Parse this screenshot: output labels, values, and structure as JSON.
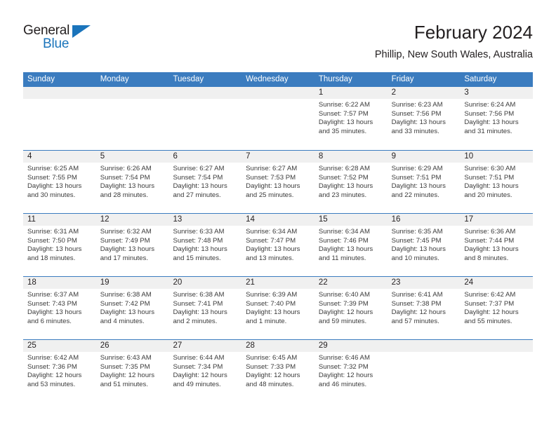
{
  "brand": {
    "name_top": "General",
    "name_bottom": "Blue",
    "accent_color": "#1a74bb"
  },
  "header": {
    "title": "February 2024",
    "subtitle": "Phillip, New South Wales, Australia"
  },
  "theme": {
    "header_blue": "#3b7cbf",
    "day_band_gray": "#f0f0f0",
    "text_dark": "#231f20"
  },
  "weekdays": [
    "Sunday",
    "Monday",
    "Tuesday",
    "Wednesday",
    "Thursday",
    "Friday",
    "Saturday"
  ],
  "weeks": [
    [
      {
        "day": "",
        "sunrise": "",
        "sunset": "",
        "daylight_1": "",
        "daylight_2": ""
      },
      {
        "day": "",
        "sunrise": "",
        "sunset": "",
        "daylight_1": "",
        "daylight_2": ""
      },
      {
        "day": "",
        "sunrise": "",
        "sunset": "",
        "daylight_1": "",
        "daylight_2": ""
      },
      {
        "day": "",
        "sunrise": "",
        "sunset": "",
        "daylight_1": "",
        "daylight_2": ""
      },
      {
        "day": "1",
        "sunrise": "Sunrise: 6:22 AM",
        "sunset": "Sunset: 7:57 PM",
        "daylight_1": "Daylight: 13 hours",
        "daylight_2": "and 35 minutes."
      },
      {
        "day": "2",
        "sunrise": "Sunrise: 6:23 AM",
        "sunset": "Sunset: 7:56 PM",
        "daylight_1": "Daylight: 13 hours",
        "daylight_2": "and 33 minutes."
      },
      {
        "day": "3",
        "sunrise": "Sunrise: 6:24 AM",
        "sunset": "Sunset: 7:56 PM",
        "daylight_1": "Daylight: 13 hours",
        "daylight_2": "and 31 minutes."
      }
    ],
    [
      {
        "day": "4",
        "sunrise": "Sunrise: 6:25 AM",
        "sunset": "Sunset: 7:55 PM",
        "daylight_1": "Daylight: 13 hours",
        "daylight_2": "and 30 minutes."
      },
      {
        "day": "5",
        "sunrise": "Sunrise: 6:26 AM",
        "sunset": "Sunset: 7:54 PM",
        "daylight_1": "Daylight: 13 hours",
        "daylight_2": "and 28 minutes."
      },
      {
        "day": "6",
        "sunrise": "Sunrise: 6:27 AM",
        "sunset": "Sunset: 7:54 PM",
        "daylight_1": "Daylight: 13 hours",
        "daylight_2": "and 27 minutes."
      },
      {
        "day": "7",
        "sunrise": "Sunrise: 6:27 AM",
        "sunset": "Sunset: 7:53 PM",
        "daylight_1": "Daylight: 13 hours",
        "daylight_2": "and 25 minutes."
      },
      {
        "day": "8",
        "sunrise": "Sunrise: 6:28 AM",
        "sunset": "Sunset: 7:52 PM",
        "daylight_1": "Daylight: 13 hours",
        "daylight_2": "and 23 minutes."
      },
      {
        "day": "9",
        "sunrise": "Sunrise: 6:29 AM",
        "sunset": "Sunset: 7:51 PM",
        "daylight_1": "Daylight: 13 hours",
        "daylight_2": "and 22 minutes."
      },
      {
        "day": "10",
        "sunrise": "Sunrise: 6:30 AM",
        "sunset": "Sunset: 7:51 PM",
        "daylight_1": "Daylight: 13 hours",
        "daylight_2": "and 20 minutes."
      }
    ],
    [
      {
        "day": "11",
        "sunrise": "Sunrise: 6:31 AM",
        "sunset": "Sunset: 7:50 PM",
        "daylight_1": "Daylight: 13 hours",
        "daylight_2": "and 18 minutes."
      },
      {
        "day": "12",
        "sunrise": "Sunrise: 6:32 AM",
        "sunset": "Sunset: 7:49 PM",
        "daylight_1": "Daylight: 13 hours",
        "daylight_2": "and 17 minutes."
      },
      {
        "day": "13",
        "sunrise": "Sunrise: 6:33 AM",
        "sunset": "Sunset: 7:48 PM",
        "daylight_1": "Daylight: 13 hours",
        "daylight_2": "and 15 minutes."
      },
      {
        "day": "14",
        "sunrise": "Sunrise: 6:34 AM",
        "sunset": "Sunset: 7:47 PM",
        "daylight_1": "Daylight: 13 hours",
        "daylight_2": "and 13 minutes."
      },
      {
        "day": "15",
        "sunrise": "Sunrise: 6:34 AM",
        "sunset": "Sunset: 7:46 PM",
        "daylight_1": "Daylight: 13 hours",
        "daylight_2": "and 11 minutes."
      },
      {
        "day": "16",
        "sunrise": "Sunrise: 6:35 AM",
        "sunset": "Sunset: 7:45 PM",
        "daylight_1": "Daylight: 13 hours",
        "daylight_2": "and 10 minutes."
      },
      {
        "day": "17",
        "sunrise": "Sunrise: 6:36 AM",
        "sunset": "Sunset: 7:44 PM",
        "daylight_1": "Daylight: 13 hours",
        "daylight_2": "and 8 minutes."
      }
    ],
    [
      {
        "day": "18",
        "sunrise": "Sunrise: 6:37 AM",
        "sunset": "Sunset: 7:43 PM",
        "daylight_1": "Daylight: 13 hours",
        "daylight_2": "and 6 minutes."
      },
      {
        "day": "19",
        "sunrise": "Sunrise: 6:38 AM",
        "sunset": "Sunset: 7:42 PM",
        "daylight_1": "Daylight: 13 hours",
        "daylight_2": "and 4 minutes."
      },
      {
        "day": "20",
        "sunrise": "Sunrise: 6:38 AM",
        "sunset": "Sunset: 7:41 PM",
        "daylight_1": "Daylight: 13 hours",
        "daylight_2": "and 2 minutes."
      },
      {
        "day": "21",
        "sunrise": "Sunrise: 6:39 AM",
        "sunset": "Sunset: 7:40 PM",
        "daylight_1": "Daylight: 13 hours",
        "daylight_2": "and 1 minute."
      },
      {
        "day": "22",
        "sunrise": "Sunrise: 6:40 AM",
        "sunset": "Sunset: 7:39 PM",
        "daylight_1": "Daylight: 12 hours",
        "daylight_2": "and 59 minutes."
      },
      {
        "day": "23",
        "sunrise": "Sunrise: 6:41 AM",
        "sunset": "Sunset: 7:38 PM",
        "daylight_1": "Daylight: 12 hours",
        "daylight_2": "and 57 minutes."
      },
      {
        "day": "24",
        "sunrise": "Sunrise: 6:42 AM",
        "sunset": "Sunset: 7:37 PM",
        "daylight_1": "Daylight: 12 hours",
        "daylight_2": "and 55 minutes."
      }
    ],
    [
      {
        "day": "25",
        "sunrise": "Sunrise: 6:42 AM",
        "sunset": "Sunset: 7:36 PM",
        "daylight_1": "Daylight: 12 hours",
        "daylight_2": "and 53 minutes."
      },
      {
        "day": "26",
        "sunrise": "Sunrise: 6:43 AM",
        "sunset": "Sunset: 7:35 PM",
        "daylight_1": "Daylight: 12 hours",
        "daylight_2": "and 51 minutes."
      },
      {
        "day": "27",
        "sunrise": "Sunrise: 6:44 AM",
        "sunset": "Sunset: 7:34 PM",
        "daylight_1": "Daylight: 12 hours",
        "daylight_2": "and 49 minutes."
      },
      {
        "day": "28",
        "sunrise": "Sunrise: 6:45 AM",
        "sunset": "Sunset: 7:33 PM",
        "daylight_1": "Daylight: 12 hours",
        "daylight_2": "and 48 minutes."
      },
      {
        "day": "29",
        "sunrise": "Sunrise: 6:46 AM",
        "sunset": "Sunset: 7:32 PM",
        "daylight_1": "Daylight: 12 hours",
        "daylight_2": "and 46 minutes."
      },
      {
        "day": "",
        "sunrise": "",
        "sunset": "",
        "daylight_1": "",
        "daylight_2": ""
      },
      {
        "day": "",
        "sunrise": "",
        "sunset": "",
        "daylight_1": "",
        "daylight_2": ""
      }
    ]
  ]
}
